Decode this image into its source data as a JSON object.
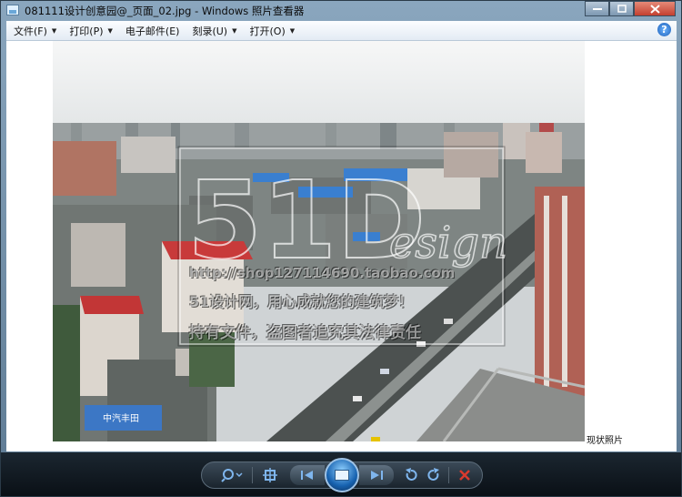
{
  "window": {
    "title": "081111设计创意园@_页面_02.jpg - Windows 照片查看器"
  },
  "menu": {
    "items": [
      {
        "label": "文件(F)"
      },
      {
        "label": "打印(P)"
      },
      {
        "label": "电子邮件(E)"
      },
      {
        "label": "刻录(U)"
      },
      {
        "label": "打开(O)"
      }
    ],
    "help_icon": "help-icon"
  },
  "photo": {
    "watermark_url": "http://shop127114690.taobao.com",
    "watermark_line2": "51设计网，用心成就您的建筑梦！",
    "watermark_line3": "持有文件，盗图者追究其法律责任",
    "watermark_logo": "51Design",
    "billboard_text": "中汽丰田"
  },
  "caption": "现状照片",
  "controls": {
    "zoom": "zoom-icon",
    "fit": "actual-size-icon",
    "prev": "previous-icon",
    "slideshow": "slideshow-icon",
    "next": "next-icon",
    "rotate_ccw": "rotate-counterclockwise-icon",
    "rotate_cw": "rotate-clockwise-icon",
    "delete": "delete-icon"
  },
  "colors": {
    "accent": "#3a7fd0",
    "close": "#c34030"
  }
}
